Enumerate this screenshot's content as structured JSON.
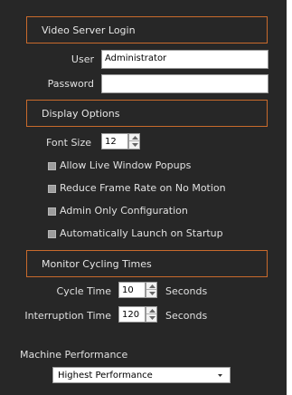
{
  "sections": {
    "login": "Video Server Login",
    "display": "Display Options",
    "cycling": "Monitor Cycling Times"
  },
  "login": {
    "user_label": "User",
    "user_value": "Administrator",
    "password_label": "Password",
    "password_value": ""
  },
  "display": {
    "font_size_label": "Font Size",
    "font_size_value": "12",
    "options": [
      "Allow Live Window Popups",
      "Reduce Frame Rate on No Motion",
      "Admin Only Configuration",
      "Automatically Launch on Startup"
    ]
  },
  "cycling": {
    "cycle_time_label": "Cycle Time",
    "cycle_time_value": "10",
    "interruption_label": "Interruption Time",
    "interruption_value": "120",
    "unit": "Seconds"
  },
  "performance": {
    "label": "Machine Performance",
    "selected": "Highest Performance"
  },
  "colors": {
    "panel_bg": "#272727",
    "accent_border": "#c86a2c"
  }
}
